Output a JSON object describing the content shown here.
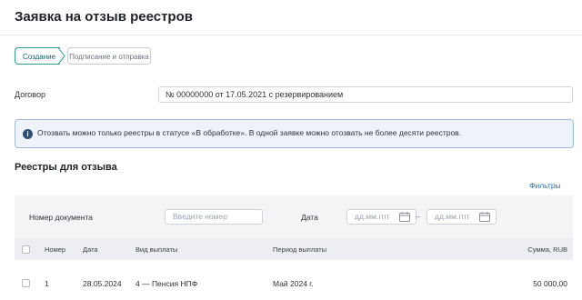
{
  "page": {
    "title": "Заявка на отзыв реестров"
  },
  "stepper": {
    "steps": [
      {
        "label": "Создание",
        "active": true
      },
      {
        "label": "Подписание и отправка",
        "active": false
      }
    ]
  },
  "contract": {
    "label": "Договор",
    "value": "№ 00000000  от 17.05.2021 с резервированием"
  },
  "info": {
    "icon": "info-icon",
    "text": "Отозвать можно только реестры в статусе «В обработке». В одной заявке можно отозвать не более десяти реестров."
  },
  "registries": {
    "title": "Реестры для отзыва",
    "filters_link": "Фильтры",
    "filters": {
      "doc_number_label": "Номер документа",
      "doc_number_placeholder": "Введите номер",
      "date_label": "Дата",
      "date_from_placeholder": "дд.мм.гггг",
      "date_separator": "–",
      "date_to_placeholder": "дд.мм.гггг"
    },
    "columns": [
      "Номер",
      "Дата",
      "Вид выплаты",
      "Период выплаты",
      "Сумма, RUB"
    ],
    "rows": [
      {
        "number": "1",
        "date": "28.05.2024",
        "payment_type": "4 — Пенсия НПФ",
        "period": "Май 2024 г.",
        "amount": "50 000,00"
      }
    ]
  },
  "colors": {
    "accent_teal": "#2a9d9a",
    "link_blue": "#1f6fbf",
    "info_bg": "#eef3fa",
    "info_border": "#9fb9dc"
  }
}
